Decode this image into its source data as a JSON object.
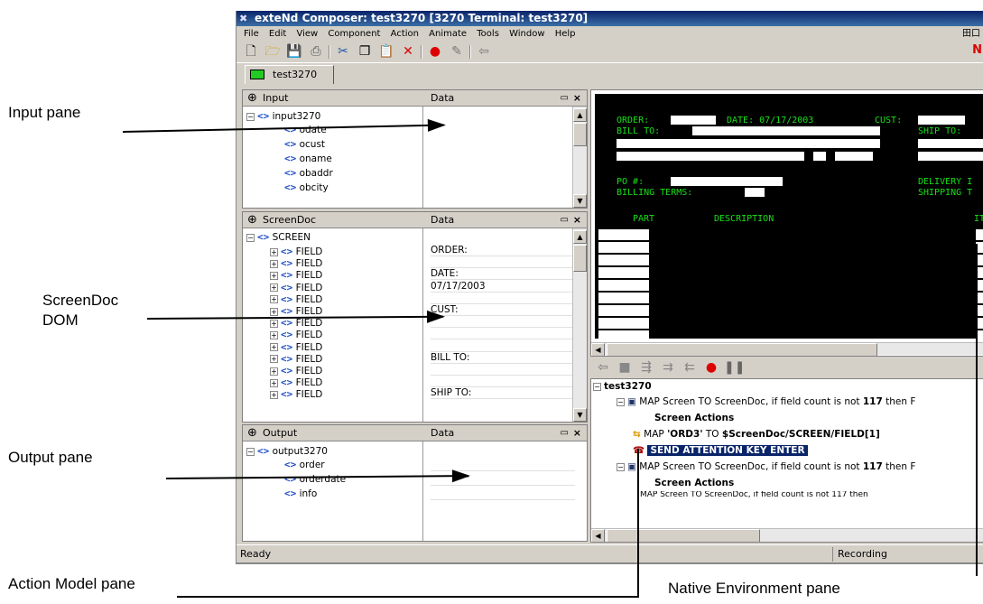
{
  "callouts": {
    "input_pane": "Input pane",
    "screendoc_dom": "ScreenDoc\nDOM",
    "output_pane": "Output pane",
    "action_model_pane": "Action Model pane",
    "native_env_pane": "Native Environment pane"
  },
  "window": {
    "title": "exteNd Composer: test3270 [3270 Terminal: test3270]"
  },
  "menu": [
    "File",
    "Edit",
    "View",
    "Component",
    "Action",
    "Animate",
    "Tools",
    "Window",
    "Help"
  ],
  "menu_right": "田口",
  "toolbar_right_letter": "N",
  "doc_tab": "test3270",
  "input_pane": {
    "title": "Input",
    "data_header": "Data",
    "root": "input3270",
    "children": [
      "odate",
      "ocust",
      "oname",
      "obaddr",
      "obcity"
    ]
  },
  "screendoc_pane": {
    "title": "ScreenDoc",
    "data_header": "Data",
    "root": "SCREEN",
    "field_label": "FIELD",
    "values": [
      "ORDER:",
      "",
      "DATE:",
      "07/17/2003",
      "",
      "CUST:",
      "",
      "",
      "",
      "BILL TO:",
      "",
      "",
      "SHIP TO:"
    ]
  },
  "output_pane": {
    "title": "Output",
    "data_header": "Data",
    "root": "output3270",
    "children": [
      "order",
      "orderdate",
      "info"
    ]
  },
  "terminal": {
    "order_label": "ORDER:",
    "date_label": "DATE: 07/17/2003",
    "cust_label": "CUST:",
    "bill_to": "BILL TO:",
    "ship_to": "SHIP TO:",
    "po": "PO #:",
    "billing_terms": "BILLING TERMS:",
    "delivery": "DELIVERY I",
    "shipping": "SHIPPING T",
    "part": "PART",
    "description": "DESCRIPTION",
    "it": "IT"
  },
  "actions": {
    "root": "test3270",
    "map1_prefix": "MAP Screen TO ScreenDoc, if field count is not ",
    "map1_count": "117",
    "map1_suffix": " then F",
    "screen_actions": "Screen Actions",
    "map_ord_prefix": "MAP ",
    "map_ord_value": "'ORD3'",
    "map_ord_mid": " TO ",
    "map_ord_target": "$ScreenDoc/SCREEN/FIELD[1]",
    "send_key": "SEND ATTENTION KEY ENTER",
    "map2_prefix": "MAP Screen TO ScreenDoc, if field count is not ",
    "map2_count": "117",
    "map2_suffix": " then F",
    "screen_actions2": "Screen Actions",
    "map3_partial": "MAP Screen TO ScreenDoc, if field count is not 117 then"
  },
  "status": {
    "left": "Ready",
    "right": "Recording"
  }
}
